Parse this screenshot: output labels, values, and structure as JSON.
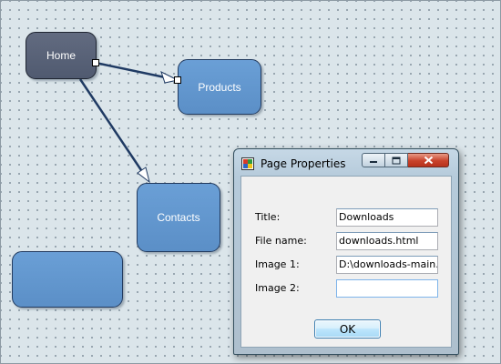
{
  "diagram": {
    "nodes": [
      {
        "id": "home",
        "label": "Home",
        "selected": true
      },
      {
        "id": "products",
        "label": "Products",
        "selected": false
      },
      {
        "id": "contacts",
        "label": "Contacts",
        "selected": false
      },
      {
        "id": "unnamed",
        "label": "",
        "selected": false
      }
    ],
    "links": [
      {
        "from": "home",
        "to": "products"
      },
      {
        "from": "home",
        "to": "contacts"
      }
    ],
    "colors": {
      "canvas": "#dbe5ea",
      "node_fill": "#6396cf",
      "node_selected_fill": "#5a6378",
      "link": "#1f3a63"
    }
  },
  "dialog": {
    "title": "Page Properties",
    "icon": "page-properties-icon",
    "caption_buttons": [
      "minimize-icon",
      "maximize-icon",
      "close-icon"
    ],
    "fields": {
      "title": {
        "label": "Title:",
        "value": "Downloads"
      },
      "file_name": {
        "label": "File name:",
        "value": "downloads.html"
      },
      "image1": {
        "label": "Image 1:",
        "value": "D:\\downloads-main.pn"
      },
      "image2": {
        "label": "Image 2:",
        "value": ""
      }
    },
    "ok_label": "OK",
    "colors": {
      "close_button": "#c8422b",
      "ok_button": "#bee6fd"
    }
  }
}
